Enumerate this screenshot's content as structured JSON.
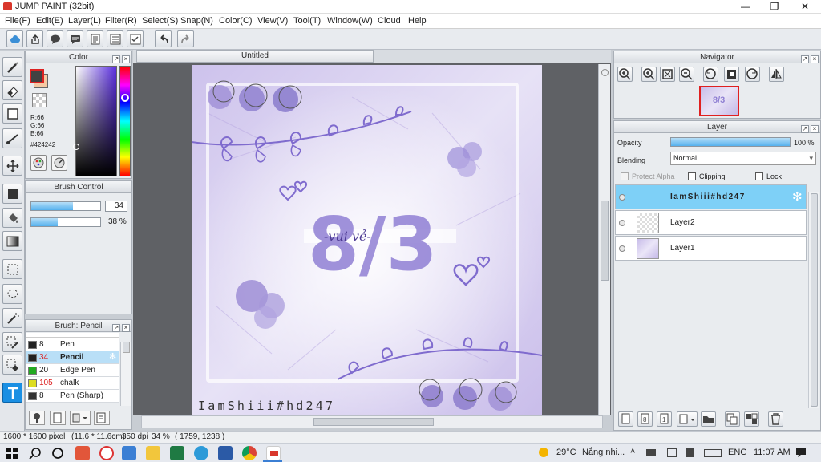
{
  "window": {
    "title": "JUMP PAINT (32bit)",
    "minimize": "—",
    "maximize": "❐",
    "close": "✕"
  },
  "menu": [
    "File(F)",
    "Edit(E)",
    "Layer(L)",
    "Filter(R)",
    "Select(S)",
    "Snap(N)",
    "Color(C)",
    "View(V)",
    "Tool(T)",
    "Window(W)",
    "Cloud",
    "Help"
  ],
  "color_panel": {
    "title": "Color",
    "r": "R:66",
    "g": "G:66",
    "b": "B:66",
    "hex": "#424242",
    "fg": "#424242",
    "bg": "#f6c9a3"
  },
  "brush_control": {
    "title": "Brush Control",
    "size_value": "34",
    "size_level": 0.6,
    "opacity_value": "38 %",
    "opacity_level": 0.38
  },
  "brush_list": {
    "title": "Brush: Pencil",
    "items": [
      {
        "size": "8",
        "name": "Pen",
        "color": "#222222",
        "selected": false
      },
      {
        "size": "34",
        "name": "Pencil",
        "color": "#222222",
        "selected": true
      },
      {
        "size": "20",
        "name": "Edge Pen",
        "color": "#22aa22",
        "selected": false
      },
      {
        "size": "105",
        "name": "chalk",
        "color": "#dddd22",
        "selected": false
      },
      {
        "size": "8",
        "name": "Pen (Sharp)",
        "color": "#333333",
        "selected": false
      }
    ]
  },
  "document": {
    "tab_title": "Untitled",
    "art_title": "8/3",
    "art_subtitle": "-vui vẻ-",
    "signature": "IamShiii#hd247"
  },
  "navigator": {
    "title": "Navigator"
  },
  "layer_panel": {
    "title": "Layer",
    "opacity_label": "Opacity",
    "opacity_value": "100 %",
    "opacity_level": 1.0,
    "blending_label": "Blending",
    "blending_value": "Normal",
    "protect_alpha": "Protect Alpha",
    "clipping": "Clipping",
    "lock": "Lock",
    "layers": [
      {
        "name": "IamShiii#hd247",
        "selected": true
      },
      {
        "name": "Layer2",
        "selected": false
      },
      {
        "name": "Layer1",
        "selected": false
      }
    ]
  },
  "status": {
    "size": "1600 * 1600 pixel",
    "cm": "(11.6 * 11.6cm)",
    "dpi": "350 dpi",
    "zoom": "34 %",
    "coords": "( 1759, 1238 )"
  },
  "taskbar": {
    "temperature": "29°C",
    "weather": "Nắng nhi...",
    "language": "ENG",
    "time": "11:07 AM"
  }
}
